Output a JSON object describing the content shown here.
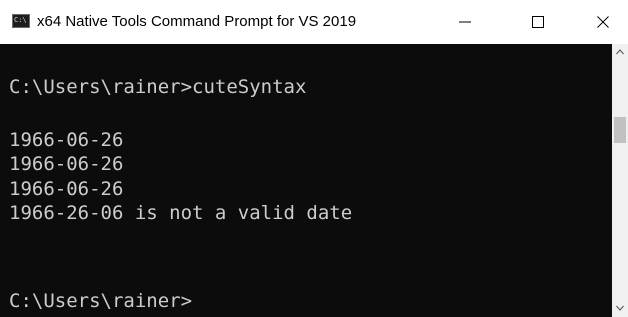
{
  "window": {
    "title": "x64 Native Tools Command Prompt for VS 2019",
    "icon_glyph": "C:\\",
    "icon": "command-prompt-icon"
  },
  "console": {
    "lines": [
      "C:\\Users\\rainer>cuteSyntax",
      "1966-06-26",
      "1966-06-26",
      "1966-06-26",
      "1966-26-06 is not a valid date",
      "C:\\Users\\rainer>"
    ],
    "text_color": "#cccccc",
    "background": "#0c0c0c"
  },
  "scrollbar": {
    "position_fraction": 0.3
  }
}
